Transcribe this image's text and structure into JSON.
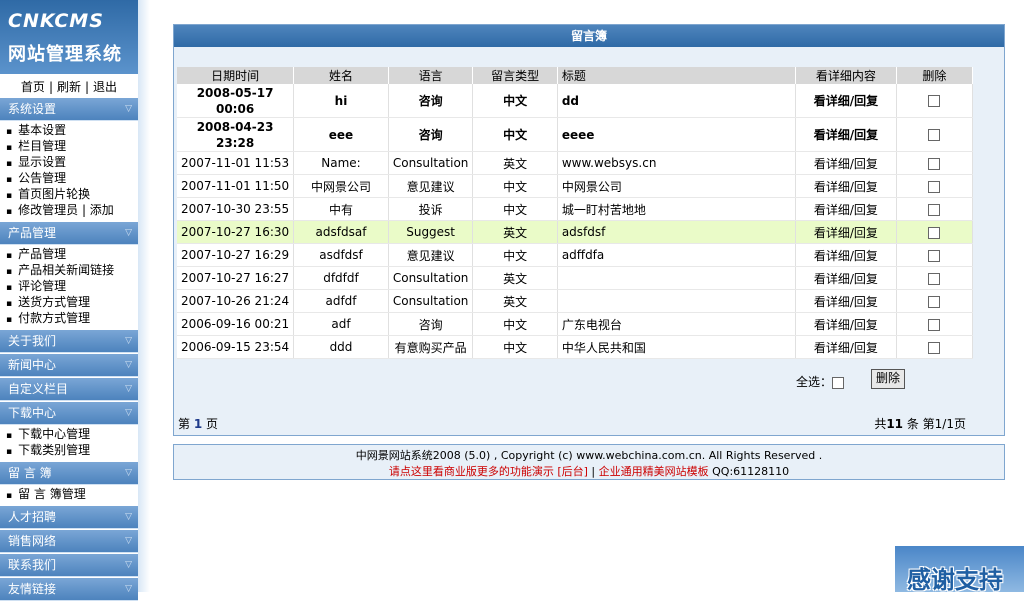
{
  "logo": {
    "line1": "CNKCMS",
    "line2": "网站管理系统"
  },
  "topnav": [
    "首页",
    "刷新",
    "退出"
  ],
  "sidebar": {
    "sec1": {
      "title": "系统设置",
      "items": [
        "基本设置",
        "栏目管理",
        "显示设置",
        "公告管理",
        "首页图片轮换"
      ],
      "last": "修改管理员",
      "last_extra": "添加"
    },
    "sec2": {
      "title": "产品管理",
      "items": [
        "产品管理",
        "产品相关新闻链接",
        "评论管理",
        "送货方式管理",
        "付款方式管理"
      ]
    },
    "sec3": {
      "title": "关于我们"
    },
    "sec4": {
      "title": "新闻中心"
    },
    "sec5": {
      "title": "自定义栏目"
    },
    "sec6": {
      "title": "下载中心",
      "items": [
        "下载中心管理",
        "下载类别管理"
      ]
    },
    "sec7": {
      "title": "留 言 簿",
      "items": [
        "留 言 簿管理"
      ]
    },
    "sec8": {
      "title": "人才招聘"
    },
    "sec9": {
      "title": "销售网络"
    },
    "sec10": {
      "title": "联系我们"
    },
    "sec11": {
      "title": "友情链接"
    }
  },
  "panel": {
    "title": "留言簿"
  },
  "table": {
    "headers": [
      "日期时间",
      "姓名",
      "语言",
      "留言类型",
      "标题",
      "看详细内容",
      "删除"
    ],
    "rows": [
      {
        "date": "2008-05-17 00:06",
        "name": "hi",
        "lang": "咨询",
        "type": "中文",
        "title": "dd",
        "action": "看详细/回复"
      },
      {
        "date": "2008-04-23 23:28",
        "name": "eee",
        "lang": "咨询",
        "type": "中文",
        "title": "eeee",
        "action": "看详细/回复"
      },
      {
        "date": "2007-11-01 11:53",
        "name": "Name:",
        "lang": "Consultation",
        "type": "英文",
        "title": "www.websys.cn",
        "action": "看详细/回复"
      },
      {
        "date": "2007-11-01 11:50",
        "name": "中网景公司",
        "lang": "意见建议",
        "type": "中文",
        "title": "中网景公司",
        "action": "看详细/回复"
      },
      {
        "date": "2007-10-30 23:55",
        "name": "中有",
        "lang": "投诉",
        "type": "中文",
        "title": "城一盯村苦地地",
        "action": "看详细/回复"
      },
      {
        "date": "2007-10-27 16:30",
        "name": "adsfdsaf",
        "lang": "Suggest",
        "type": "英文",
        "title": "adsfdsf",
        "action": "看详细/回复"
      },
      {
        "date": "2007-10-27 16:29",
        "name": "asdfdsf",
        "lang": "意见建议",
        "type": "中文",
        "title": "adffdfa",
        "action": "看详细/回复"
      },
      {
        "date": "2007-10-27 16:27",
        "name": "dfdfdf",
        "lang": "Consultation",
        "type": "英文",
        "title": "",
        "action": "看详细/回复"
      },
      {
        "date": "2007-10-26 21:24",
        "name": "adfdf",
        "lang": "Consultation",
        "type": "英文",
        "title": "",
        "action": "看详细/回复"
      },
      {
        "date": "2006-09-16 00:21",
        "name": "adf",
        "lang": "咨询",
        "type": "中文",
        "title": "广东电视台",
        "action": "看详细/回复"
      },
      {
        "date": "2006-09-15 23:54",
        "name": "ddd",
        "lang": "有意购买产品",
        "type": "中文",
        "title": "中华人民共和国",
        "action": "看详细/回复"
      }
    ]
  },
  "select_all": "全选：",
  "delete_button": "删除",
  "pagination": {
    "page_prefix": "第",
    "page": "1",
    "page_suffix": "页",
    "summary_prefix": "共",
    "total": "11",
    "summary_suffix": "条 第1/1页"
  },
  "footer": {
    "line1": "中网景网站系统2008 (5.0) , Copyright (c) www.webchina.com.cn. All Rights Reserved .",
    "line2a": "请点这里看商业版更多的功能演示 [后台]",
    "sep": "|",
    "line2b": "企业通用精美网站模板",
    "qq": "QQ:61128110"
  },
  "thanks": "感谢支持"
}
